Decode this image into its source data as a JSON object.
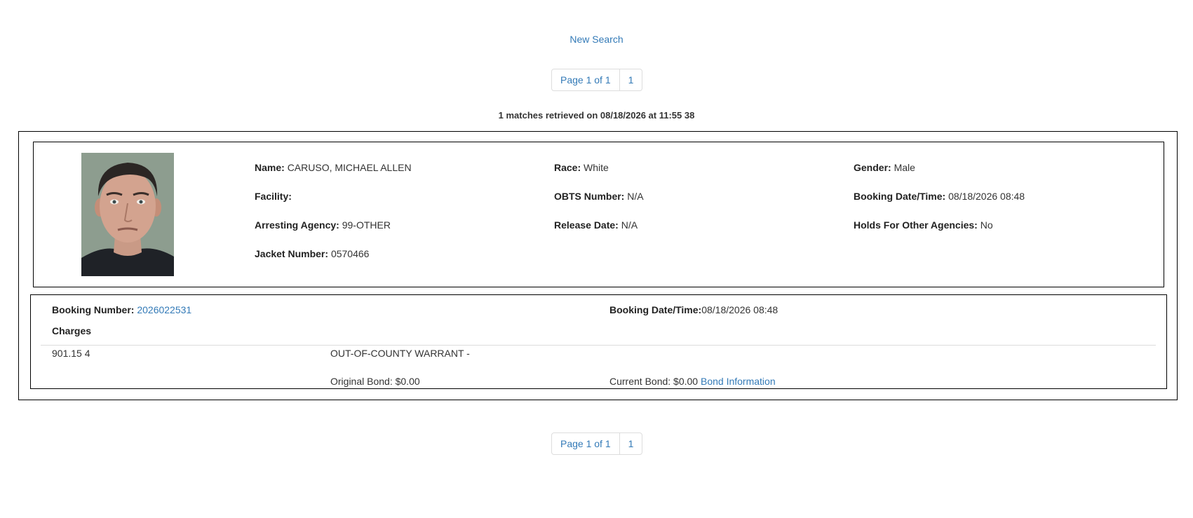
{
  "new_search_label": "New Search",
  "pager": {
    "page_label": "Page 1 of 1",
    "current_page": "1"
  },
  "matches_text": "1 matches retrieved on 08/18/2026 at 11:55 38",
  "inmate": {
    "name_label": "Name:",
    "name": "CARUSO, MICHAEL ALLEN",
    "race_label": "Race:",
    "race": "White",
    "gender_label": "Gender:",
    "gender": "Male",
    "facility_label": "Facility:",
    "facility": "",
    "obts_label": "OBTS Number:",
    "obts": "N/A",
    "booking_dt_label": "Booking Date/Time:",
    "booking_dt": "08/18/2026 08:48",
    "agency_label": "Arresting Agency:",
    "agency": "99-OTHER",
    "release_label": "Release Date:",
    "release": "N/A",
    "holds_label": "Holds For Other Agencies:",
    "holds": "No",
    "jacket_label": "Jacket Number:",
    "jacket": "0570466"
  },
  "booking": {
    "number_label": "Booking Number:",
    "number": "2026022531",
    "dt_label": "Booking Date/Time:",
    "dt": "08/18/2026 08:48",
    "charges_title": "Charges",
    "charges": [
      {
        "statute": "901.15 4",
        "description": "OUT-OF-COUNTY WARRANT -",
        "original_bond": "Original Bond: $0.00",
        "current_bond": "Current Bond: $0.00",
        "bond_link": "Bond Information"
      }
    ]
  },
  "colors": {
    "link": "#337ab7",
    "text": "#333333",
    "border": "#000000"
  }
}
